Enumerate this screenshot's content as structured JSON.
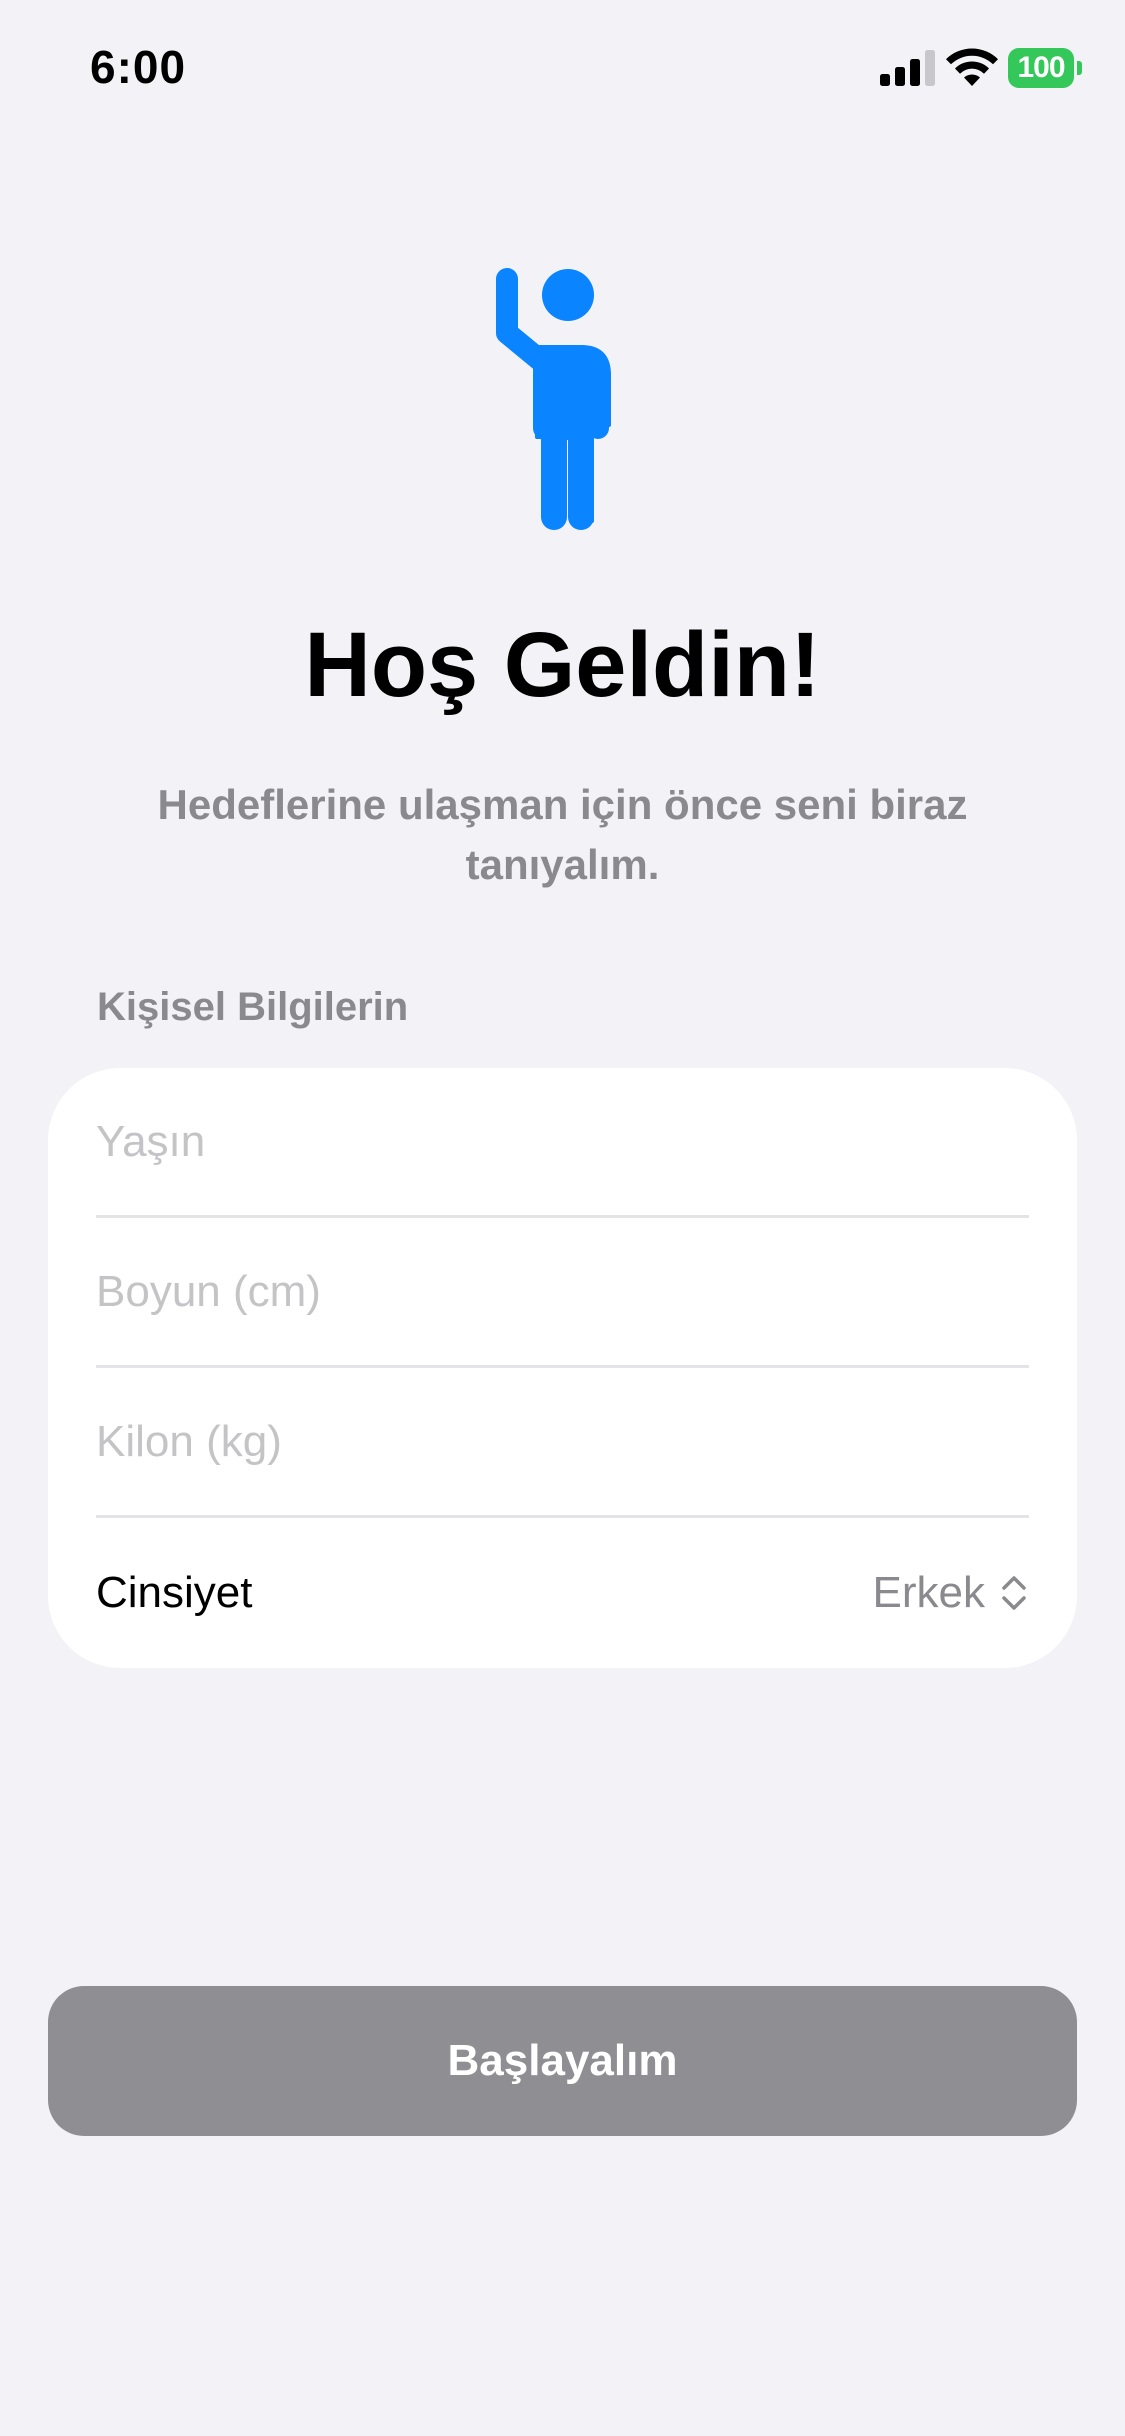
{
  "status_bar": {
    "time": "6:00",
    "battery_level": "100",
    "signal_bars_active": 3,
    "signal_bars_total": 4,
    "battery_color": "#34C759"
  },
  "hero": {
    "icon": "figure-wave-icon",
    "icon_color": "#0A84FF"
  },
  "welcome": {
    "title": "Hoş Geldin!",
    "subtitle": "Hedeflerine ulaşman için önce seni biraz tanıyalım."
  },
  "form": {
    "section_title": "Kişisel Bilgilerin",
    "fields": [
      {
        "placeholder": "Yaşın",
        "value": ""
      },
      {
        "placeholder": "Boyun (cm)",
        "value": ""
      },
      {
        "placeholder": "Kilon (kg)",
        "value": ""
      }
    ],
    "gender": {
      "label": "Cinsiyet",
      "selected": "Erkek",
      "icon": "chevron-up-down-icon"
    }
  },
  "actions": {
    "start_label": "Başlayalım",
    "start_color": "#8E8E93"
  }
}
